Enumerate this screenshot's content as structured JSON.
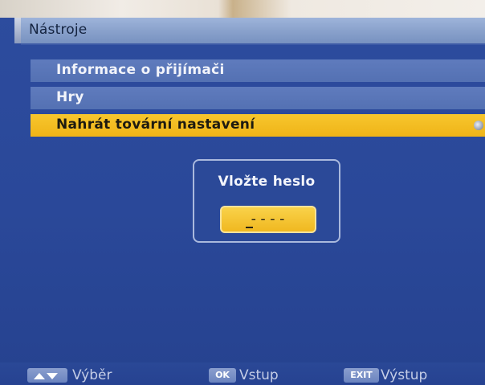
{
  "title": "Nástroje",
  "menu": {
    "items": [
      {
        "label": "Informace o přijímači"
      },
      {
        "label": "Hry"
      },
      {
        "label": "Nahrát tovární nastavení"
      }
    ]
  },
  "dialog": {
    "prompt": "Vložte heslo",
    "password_value": "----"
  },
  "footer": {
    "hints": [
      {
        "key": "",
        "icon": "up-down-arrows-icon",
        "label": "Výběr"
      },
      {
        "key": "OK",
        "label": "Vstup"
      },
      {
        "key": "EXIT",
        "label": "Výstup"
      }
    ]
  },
  "colors": {
    "background": "#2c4a9c",
    "menu_item": "#5f7bbd",
    "selected": "#f7c62d",
    "title_bar": "#8aa2cc"
  }
}
